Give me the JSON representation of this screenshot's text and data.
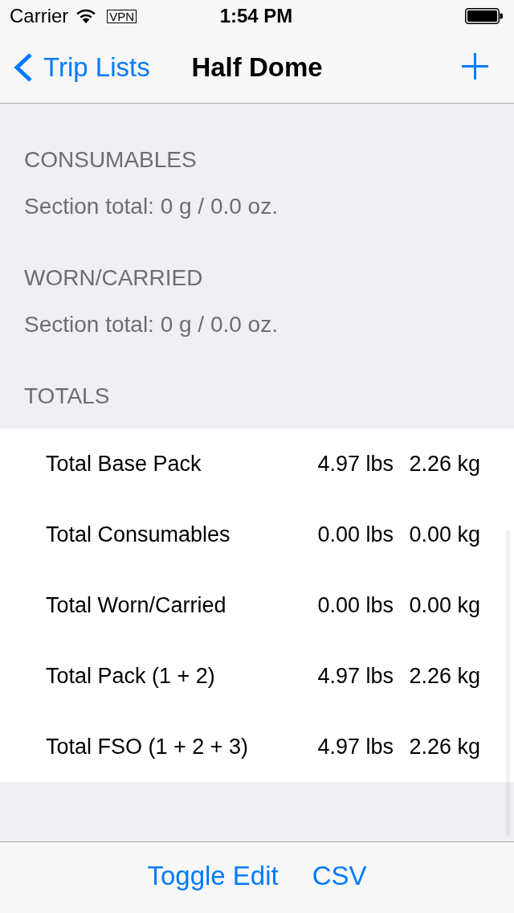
{
  "status_bar": {
    "carrier": "Carrier",
    "vpn": "VPN",
    "time": "1:54 PM"
  },
  "nav_bar": {
    "back": "Trip Lists",
    "title": "Half Dome"
  },
  "sections": [
    {
      "header": "CONSUMABLES",
      "footer": "Section total: 0 g / 0.0 oz."
    },
    {
      "header": "WORN/CARRIED",
      "footer": "Section total: 0 g / 0.0 oz."
    }
  ],
  "totals": {
    "header": "TOTALS",
    "rows": [
      {
        "label": "Total Base Pack",
        "pounds": "4.97 lbs",
        "kilograms": "2.26 kg"
      },
      {
        "label": "Total Consumables",
        "pounds": "0.00 lbs",
        "kilograms": "0.00 kg"
      },
      {
        "label": "Total Worn/Carried",
        "pounds": "0.00 lbs",
        "kilograms": "0.00 kg"
      },
      {
        "label": "Total Pack (1 + 2)",
        "pounds": "4.97 lbs",
        "kilograms": "2.26 kg"
      },
      {
        "label": "Total FSO (1 + 2 + 3)",
        "pounds": "4.97 lbs",
        "kilograms": "2.26 kg"
      }
    ]
  },
  "toolbar": {
    "buttons": [
      "Toggle Edit",
      "CSV"
    ]
  }
}
